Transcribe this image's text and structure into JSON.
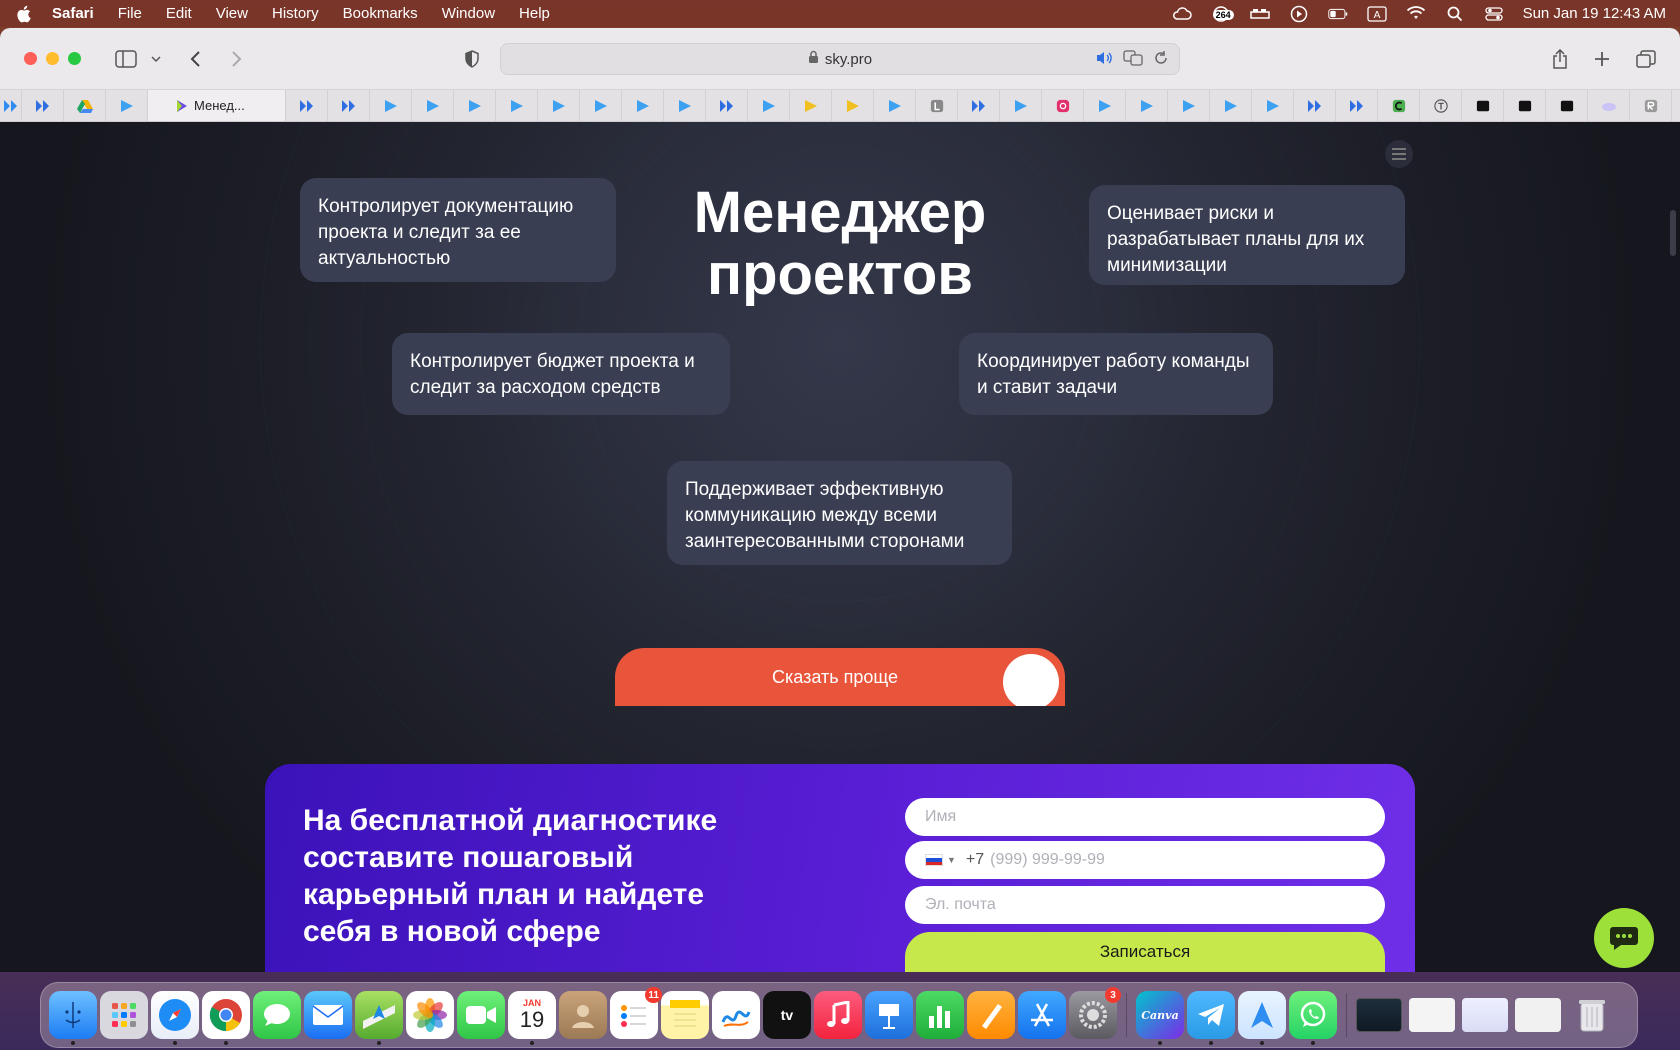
{
  "menubar": {
    "app_name": "Safari",
    "items": [
      "File",
      "Edit",
      "View",
      "History",
      "Bookmarks",
      "Window",
      "Help"
    ],
    "status_badge": "264",
    "clock": "Sun Jan 19  12:43 AM"
  },
  "browser": {
    "url": "sky.pro",
    "active_tab_label": "Менед..."
  },
  "page": {
    "title_line1": "Менеджер",
    "title_line2": "проектов",
    "cards": {
      "docs": "Контролирует документацию проекта и следит за ее актуальностью",
      "risks": "Оценивает риски и разрабатывает планы для их минимизации",
      "budget": "Контролирует бюджет проекта и следит за расходом средств",
      "team": "Координирует работу команды и ставит задачи",
      "communication": "Поддерживает эффективную коммуникацию между всеми заинтересованными сторонами"
    },
    "cta_label": "Сказать проще",
    "promo": {
      "heading": "На бесплатной диагностике составите пошаговый карьерный план и найдете себя в новой сфере",
      "name_placeholder": "Имя",
      "phone_code": "+7",
      "phone_placeholder": "(999) 999-99-99",
      "email_placeholder": "Эл. почта",
      "submit_label": "Записаться"
    }
  },
  "dock": {
    "calendar_month": "JAN",
    "calendar_day": "19",
    "reminders_badge": "11",
    "settings_badge": "3",
    "canva_label": "Canva"
  },
  "colors": {
    "accent_orange": "#e8553a",
    "promo_purple": "#5a1fd6",
    "submit_green": "#c6e84a",
    "card_bg": "#3a3e52"
  }
}
